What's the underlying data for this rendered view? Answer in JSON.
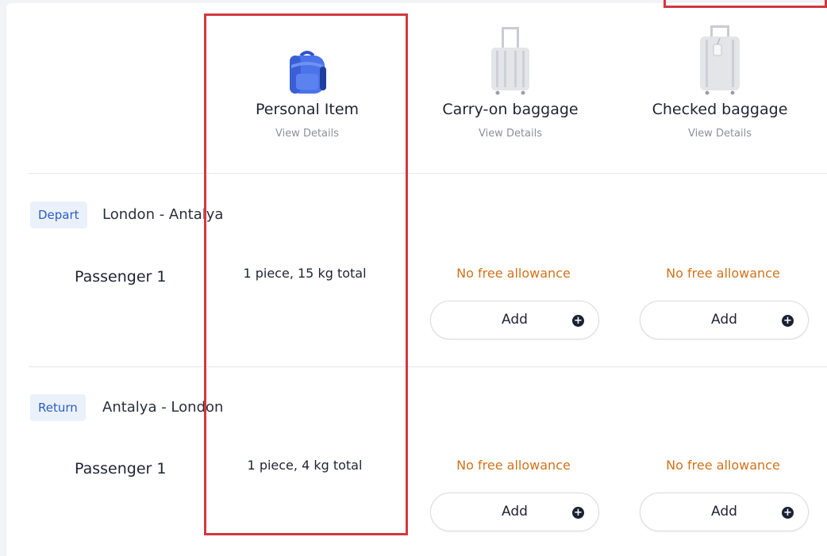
{
  "columns": [
    {
      "title": "Personal Item",
      "details": "View Details",
      "icon": "backpack-icon"
    },
    {
      "title": "Carry-on baggage",
      "details": "View Details",
      "icon": "carry-on-suitcase-icon"
    },
    {
      "title": "Checked baggage",
      "details": "View Details",
      "icon": "checked-suitcase-icon"
    }
  ],
  "segments": [
    {
      "tag": "Depart",
      "route": "London - Antalya",
      "passenger": "Passenger 1",
      "personal": "1 piece, 15 kg total",
      "carry_on": "No free allowance",
      "checked": "No free allowance",
      "add_label": "Add"
    },
    {
      "tag": "Return",
      "route": "Antalya - London",
      "passenger": "Passenger 1",
      "personal": "1 piece, 4 kg total",
      "carry_on": "No free allowance",
      "checked": "No free allowance",
      "add_label": "Add"
    }
  ],
  "colors": {
    "highlight": "#d2383f",
    "no_allowance": "#d0731b",
    "tag_bg": "#eaf1fb",
    "tag_text": "#2c5ebf"
  }
}
